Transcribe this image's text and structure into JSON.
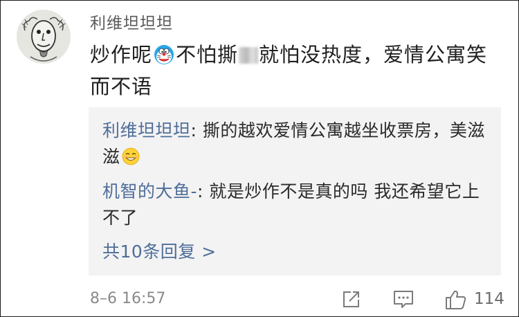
{
  "comment": {
    "username": "利维坦坦坦",
    "text_part1": "炒作呢",
    "text_part2": "不怕撕",
    "text_part3": "就怕没热度，爱情公寓笑而不语"
  },
  "replies": [
    {
      "user": "利维坦坦坦",
      "separator": ": ",
      "text": "撕的越欢爱情公寓越坐收票房，美滋滋"
    },
    {
      "user": "机智的大鱼-",
      "separator": ": ",
      "text": "就是炒作不是真的吗 我还希望它上不了"
    }
  ],
  "more_replies_label": "共10条回复 >",
  "footer": {
    "timestamp": "8–6 16:57",
    "like_count": "114"
  },
  "icons": {
    "avatar": "grayscale-cartoon-face-avatar",
    "emoji1": "doraemon-emoji",
    "emoji2": "grin-emoji",
    "share": "share-icon",
    "reply": "comment-icon",
    "like": "thumbs-up-icon"
  },
  "colors": {
    "link_blue": "#4e6d9a",
    "reply_bg": "#f3f3f3"
  }
}
